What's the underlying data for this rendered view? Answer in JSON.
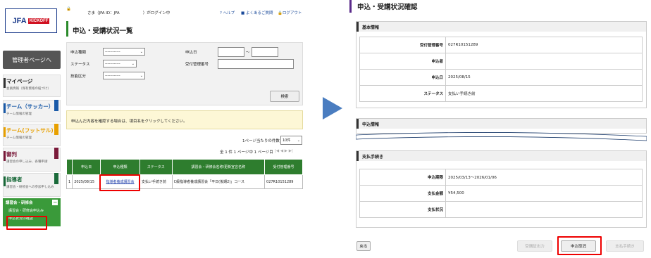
{
  "logo": {
    "jfa": "JFA",
    "kickoff": "KICKOFF"
  },
  "sidebar": {
    "admin": "管理者ページへ",
    "items": [
      {
        "title": "マイページ",
        "sub": "会員情報（保有資格の紐づけ）",
        "color": "#333333"
      },
      {
        "title": "チーム（サッカー）",
        "sub": "チーム情報の管理",
        "color": "#1a5aa8"
      },
      {
        "title": "チーム(フットサル)",
        "sub": "チーム情報の管理",
        "color": "#e8a000"
      },
      {
        "title": "審判",
        "sub": "講習会の申し込み、各種申請",
        "color": "#7a1a3a"
      },
      {
        "title": "指導者",
        "sub": "講習会・研修会への参加申し込み",
        "color": "#1a6a3a"
      }
    ],
    "kosyu": {
      "title": "講習会・研修会",
      "collapse": "ー",
      "item1": "講習会・研修会申込み",
      "item2": "申込状況の確認"
    }
  },
  "header": {
    "login": "さま（JFA ID：JFA　　　　　　）がログイン中",
    "help": "ヘルプ",
    "faq": "よくあるご質問",
    "logout": "ログアウト"
  },
  "left": {
    "title": "申込・受講状況一覧",
    "search": {
      "type_label": "申込種類",
      "type_value": "------------",
      "status_label": "ステータス",
      "status_value": "------------",
      "skill_label": "技能区分",
      "skill_value": "------------",
      "date_label": "申込日",
      "date_sep": "～",
      "recno_label": "受付管理番号",
      "search_button": "検索"
    },
    "notice": "申込んだ内容を確認する場合は、項目名をクリックしてください。",
    "perpage_label": "1ページ当たりの件数",
    "perpage_value": "10件",
    "pager": "全 1 件 1 ページ中 1 ページ目",
    "table": {
      "headers": [
        "申込日",
        "申込種類",
        "ステータス",
        "講習会・研修会名称/更新宣言名称",
        "受付管理番号"
      ],
      "rows": [
        {
          "no": "1",
          "date": "2025/08/15",
          "type": "指導者養成講習会",
          "status": "支払い手続き前",
          "name": "C級指導者養成講習会「平日(後期2)」コース",
          "recno": "027R10151289"
        }
      ]
    }
  },
  "right": {
    "title": "申込・受講状況確認",
    "basic": {
      "header": "基本情報",
      "rows": [
        {
          "k": "受付管理番号",
          "v": "027R10151289"
        },
        {
          "k": "申込者",
          "v": ""
        },
        {
          "k": "申込日",
          "v": "2025/08/15"
        },
        {
          "k": "ステータス",
          "v": "支払い手続き前"
        }
      ]
    },
    "apply": {
      "header": "申込情報"
    },
    "payment": {
      "header": "支払手続き",
      "rows": [
        {
          "k": "申込期限",
          "v": "2025/03/13〜2026/01/06"
        },
        {
          "k": "支払金額",
          "v": "¥54,500"
        },
        {
          "k": "支払状況",
          "v": ""
        }
      ]
    },
    "buttons": {
      "back": "戻る",
      "cert": "受講証出力",
      "cancel": "申込取消",
      "pay": "支払手続き"
    }
  }
}
